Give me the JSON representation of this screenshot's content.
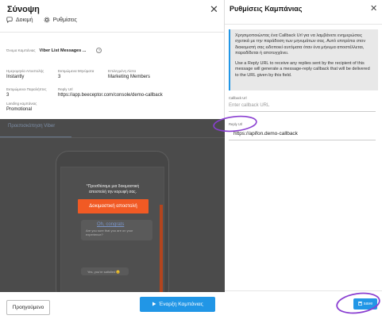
{
  "left_panel": {
    "title": "Σύνοψη",
    "close_label": "✕",
    "tabs": [
      {
        "label": "Δοκιμή",
        "icon": "chat-icon"
      },
      {
        "label": "Ρυθμίσεις",
        "icon": "gear-icon"
      }
    ],
    "campaign": {
      "label": "Όνομα Καμπάνιας",
      "name": "Viber List Messages ...",
      "info_icon": "?"
    },
    "details_row1": [
      {
        "label": "Ημερομηνία Αποστολής",
        "value": "Instantly"
      },
      {
        "label": "Εκτιμώμενα Μηνύματα",
        "value": "3"
      },
      {
        "label": "Επιλεγμένη Λίστα",
        "value": "Marketing Members"
      }
    ],
    "details_row2": [
      {
        "label": "Εκτιμώμενοι Παραλήπτες",
        "value": "3"
      },
      {
        "label": "Reply Url",
        "value": "https://app.beeceptor.com/console/demo-callback"
      }
    ],
    "details_row3": [
      {
        "label": "Landing καμπάνιας",
        "value": "Promotional"
      }
    ],
    "preview": {
      "tab_label": "Προεπισκόπηση Viber",
      "note": "*Προσθέσαμε μια δοκιμαστική αποστολή την κορυφή σας.",
      "test_button": "Δοκιμαστική αποστολή",
      "bubble_link": "Oh, congrats",
      "bubble_text": "Are you sure that you are on your experience?",
      "bubble2_text": "Yes, you're satisfied 😊"
    },
    "footer": {
      "previous_label": "Προηγούμενο",
      "start_label": "Έναρξη Καμπάνιας"
    }
  },
  "right_panel": {
    "title": "Ρυθμίσεις Καμπάνιας",
    "close_label": "✕",
    "info_paragraphs": [
      "Χρησιμοποιώντας ένα Callback Url για να λαμβάνετε ενημερώσεις σχετικά με την παράδοση των μηνυμάτων σας. Αυτό επιτρέπει στον διακομιστή σας ειδοποιεί αυτόματα όταν ένα μήνυμα αποστέλλεται, παραδίδεται ή αποτυγχάνει.",
      "Use a Reply URL to receive any replies sent by the recipient of this message will generate a message-reply callback that will be delivered to the URL given by this field."
    ],
    "callback_field": {
      "label": "Callback Url",
      "placeholder": "Enter callback URL"
    },
    "reply_field": {
      "label": "Reply Url",
      "value": "https://apifon.demo-callback"
    },
    "save_label": "save"
  },
  "colors": {
    "primary": "#2196e6",
    "orange": "#f15a24",
    "annotation": "#8a3fd1"
  }
}
